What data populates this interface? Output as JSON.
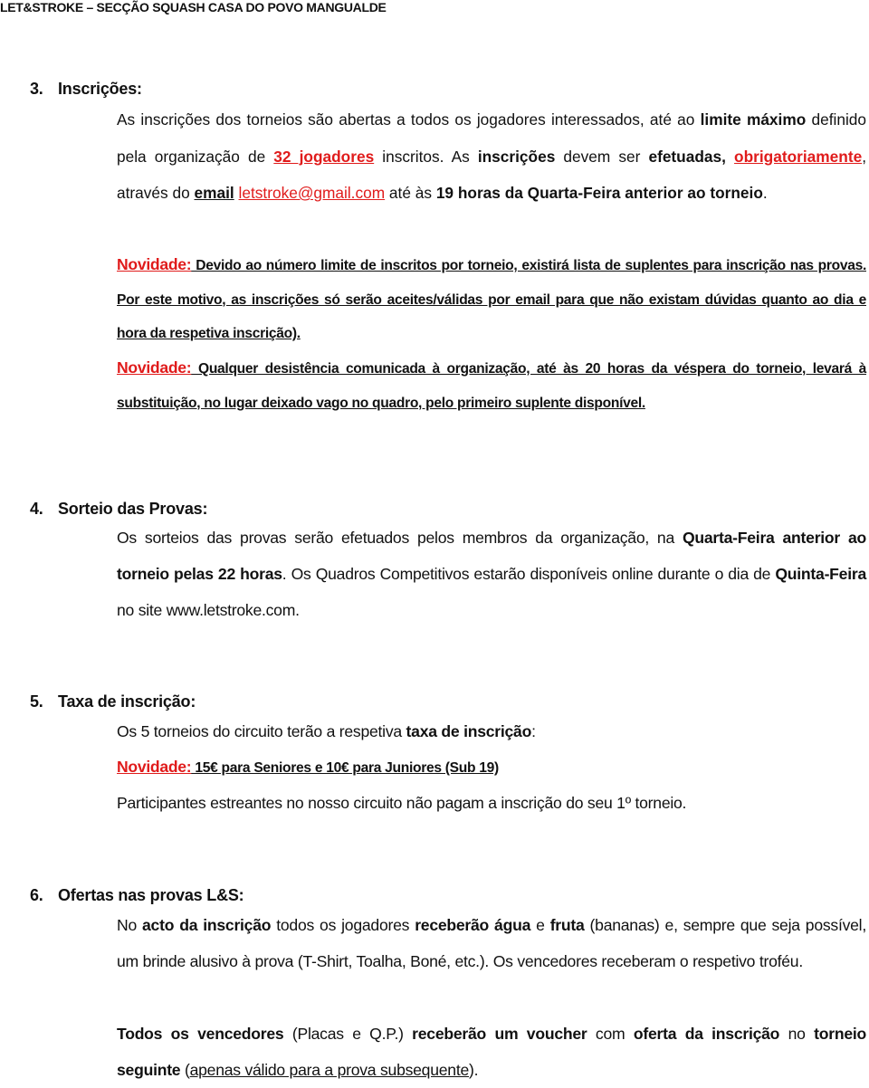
{
  "header": "LET&STROKE – SECÇÃO SQUASH CASA DO POVO MANGUALDE",
  "sections": {
    "s3": {
      "number": "3.",
      "title": "Inscrições:",
      "p1": {
        "t1": "As inscrições dos torneios são abertas a todos os jogadores interessados, até ao ",
        "b1": "limite máximo",
        "t2": " definido pela organização de ",
        "r1": "32 jogadores",
        "t3": " inscritos. As ",
        "b2": "inscrições",
        "t4": " devem ser ",
        "b3": "efetuadas,",
        "t5": " ",
        "r2": "obrigatoriamente",
        "t6": ", através do ",
        "b4": "email",
        "t7": " ",
        "email": "letstroke@gmail.com",
        "t8": " até às ",
        "b5": "19 horas da Quarta-Feira anterior ao torneio",
        "t9": "."
      },
      "novidade1": {
        "label": "Novidade:",
        "text": " Devido ao número limite de inscritos por torneio, existirá lista de suplentes para inscrição nas provas. Por este motivo, as inscrições só serão aceites/válidas por email para que não existam dúvidas quanto ao dia e hora da respetiva inscrição)."
      },
      "novidade2": {
        "label": "Novidade:",
        "text": " Qualquer desistência comunicada à organização, até às 20 horas da véspera do torneio, levará à substituição, no lugar deixado vago no quadro, pelo primeiro suplente disponível."
      }
    },
    "s4": {
      "number": "4.",
      "title": "Sorteio das Provas:",
      "p1": {
        "t1": "Os sorteios das provas serão efetuados pelos membros da organização, na ",
        "b1": "Quarta-Feira anterior ao torneio pelas 22 horas",
        "t2": ". Os Quadros Competitivos estarão disponíveis online durante o dia de ",
        "b2": "Quinta-Feira",
        "t3": " no site www.letstroke.com."
      }
    },
    "s5": {
      "number": "5.",
      "title": "Taxa de inscrição:",
      "p1": {
        "t1": "Os 5 torneios do circuito terão a respetiva ",
        "b1": "taxa de inscrição",
        "t2": ":"
      },
      "novidade": {
        "label": "Novidade:",
        "text": " 15€ para Seniores e 10€ para Juniores (Sub 19)"
      },
      "p2": "Participantes estreantes no nosso circuito não pagam a inscrição do seu 1º torneio."
    },
    "s6": {
      "number": "6.",
      "title": "Ofertas nas provas L&S:",
      "p1": {
        "t1": "No ",
        "b1": "acto da inscrição",
        "t2": " todos os jogadores ",
        "b2": "receberão água",
        "t3": " e ",
        "b3": "fruta",
        "t4": " (bananas) e, sempre que seja possível, um brinde alusivo à prova (T-Shirt, Toalha, Boné, etc.). Os vencedores receberam o respetivo troféu."
      },
      "p2": {
        "b1": "Todos os vencedores",
        "t1": " (Placas e Q.P.) ",
        "b2": "receberão um voucher",
        "t2": " com ",
        "b3": "oferta da inscrição",
        "t3": " no ",
        "b4": "torneio seguinte",
        "t4": " (",
        "u1": "apenas válido para a prova subsequente",
        "t5": ")."
      }
    }
  }
}
